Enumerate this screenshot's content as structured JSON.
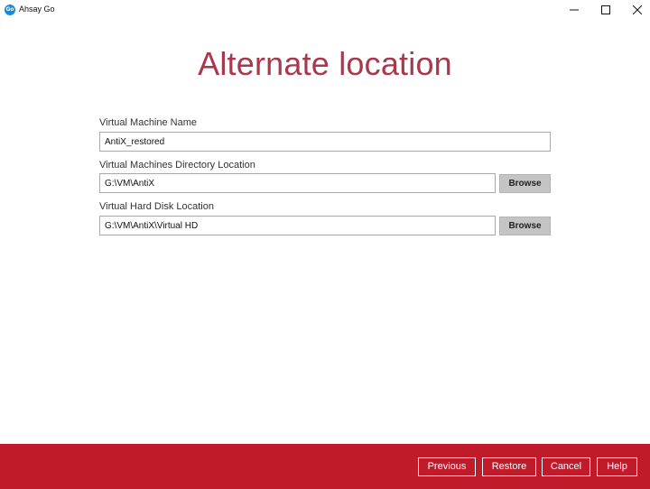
{
  "window": {
    "app_icon_text": "Go",
    "title": "Ahsay Go",
    "icons": {
      "app": "ahsay-go-icon",
      "minimize": "minimize-icon",
      "maximize": "maximize-icon",
      "close": "close-icon"
    }
  },
  "page": {
    "title": "Alternate location"
  },
  "form": {
    "vm_name": {
      "label": "Virtual Machine Name",
      "value": "AntiX_restored"
    },
    "vm_directory": {
      "label": "Virtual Machines Directory Location",
      "value": "G:\\VM\\AntiX",
      "browse_label": "Browse"
    },
    "vhd_location": {
      "label": "Virtual Hard Disk Location",
      "value": "G:\\VM\\AntiX\\Virtual HD",
      "browse_label": "Browse"
    }
  },
  "footer": {
    "previous_label": "Previous",
    "restore_label": "Restore",
    "cancel_label": "Cancel",
    "help_label": "Help"
  },
  "colors": {
    "accent_title": "#a8384b",
    "footer_bg": "#c01b2b",
    "browse_bg": "#c4c4c4",
    "app_icon": "#1a8ad4"
  }
}
